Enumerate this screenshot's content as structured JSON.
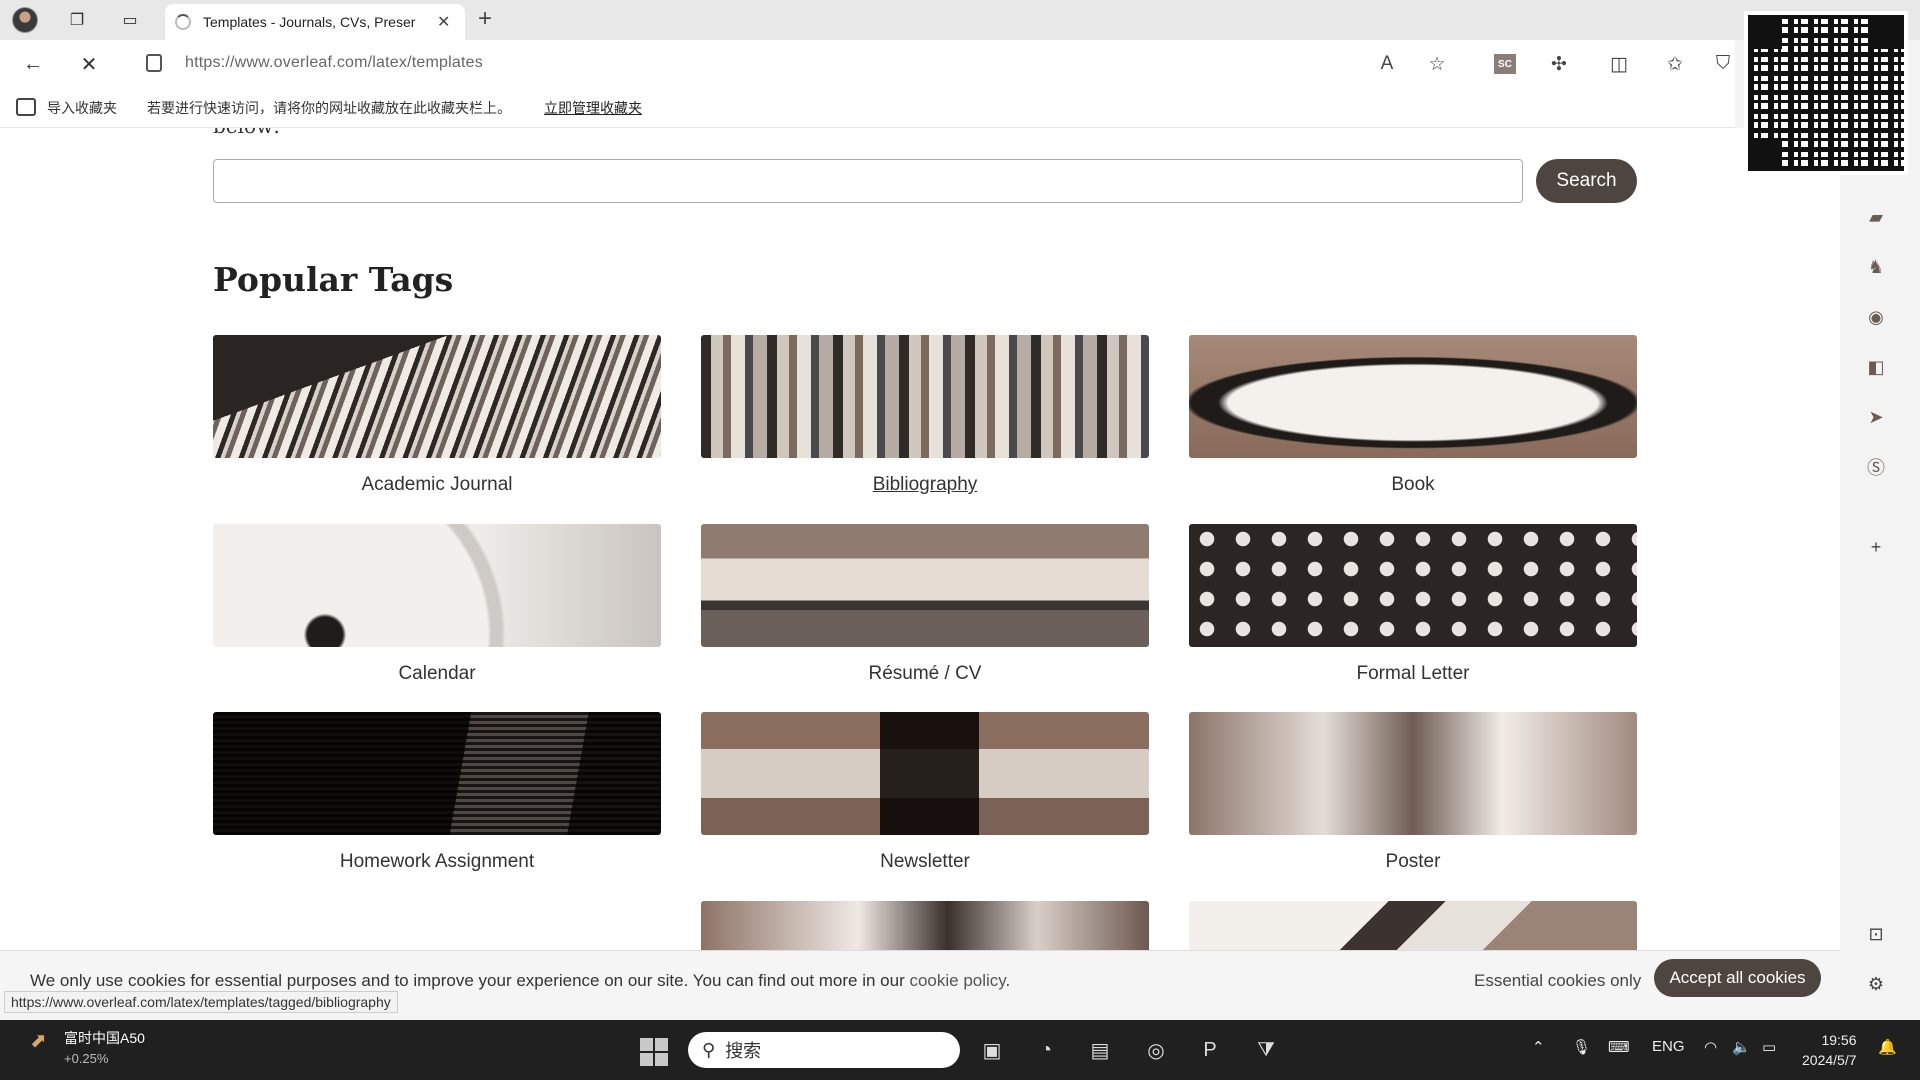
{
  "browser": {
    "tab_title": "Templates - Journals, CVs, Preser",
    "url": "https://www.overleaf.com/latex/templates",
    "favorites": {
      "import_label": "导入收藏夹",
      "hint": "若要进行快速访问，请将你的网址收藏放在此收藏夹栏上。",
      "manage_link": "立即管理收藏夹"
    },
    "status_url": "https://www.overleaf.com/latex/templates/tagged/bibliography",
    "extension_badge": "SC"
  },
  "page": {
    "clipped_text": "below:",
    "search": {
      "value": "",
      "button_label": "Search"
    },
    "section_title": "Popular Tags",
    "tags": [
      {
        "label": "Academic Journal",
        "image": "library-shelves"
      },
      {
        "label": "Bibliography",
        "image": "book-spines"
      },
      {
        "label": "Book",
        "image": "open-book"
      },
      {
        "label": "Calendar",
        "image": "clock-face"
      },
      {
        "label": "Résumé / CV",
        "image": "person-on-bench"
      },
      {
        "label": "Formal Letter",
        "image": "typewriter-keys"
      },
      {
        "label": "Homework Assignment",
        "image": "laptop-and-notebook"
      },
      {
        "label": "Newsletter",
        "image": "laptop-on-desk"
      },
      {
        "label": "Poster",
        "image": "poster-board"
      },
      {
        "label": "",
        "image": "people-photo"
      },
      {
        "label": "",
        "image": "drawing-sketch"
      }
    ]
  },
  "cookie": {
    "message": "We only use cookies for essential purposes and to improve your experience on our site. You can find out more in our ",
    "link": "cookie policy",
    "message_end": ".",
    "essential_label": "Essential cookies only",
    "accept_label": "Accept all cookies"
  },
  "taskbar": {
    "stock_name": "富时中国A50",
    "stock_change": "+0.25%",
    "search_placeholder": "搜索",
    "language": "ENG",
    "time": "19:56",
    "date": "2024/5/7"
  },
  "colors": {
    "button_dark": "#4d4540",
    "taskbar": "#202020"
  }
}
